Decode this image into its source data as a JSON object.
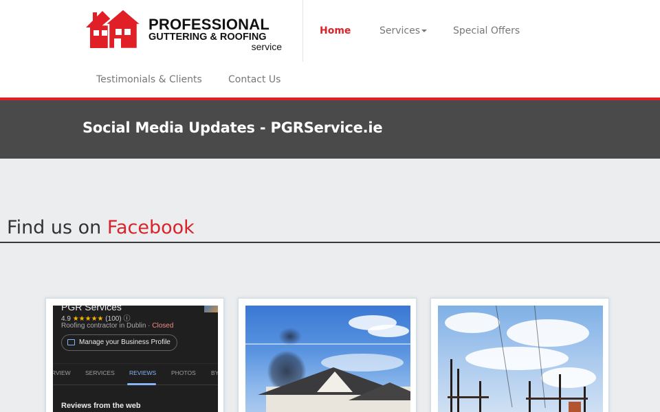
{
  "logo": {
    "line1": "PROFESSIONAL",
    "line2": "GUTTERING & ROOFING",
    "line3": "service"
  },
  "nav": {
    "home": "Home",
    "services": "Services",
    "special_offers": "Special Offers",
    "testimonials": "Testimonials & Clients",
    "contact": "Contact Us"
  },
  "banner": {
    "title": "Social Media Updates - PGRService.ie"
  },
  "section": {
    "title_prefix": "Find us on ",
    "title_accent": "Facebook"
  },
  "cards": {
    "card1": {
      "business_name": "PGR Services",
      "rating": "4.9",
      "stars": "★★★★★",
      "review_count": "(100)",
      "info_glyph": "ⓘ",
      "category": "Roofing contractor in Dublin · ",
      "status": "Closed",
      "manage_label": "Manage your Business Profile",
      "tabs": [
        "RVIEW",
        "SERVICES",
        "REVIEWS",
        "PHOTOS",
        "BY"
      ],
      "reviews_heading": "Reviews from the web"
    }
  },
  "colors": {
    "accent": "#d9232a",
    "banner_bg": "#4a4a4a",
    "red_line": "#e01f26"
  },
  "icons": {
    "logo": "house-logo-icon",
    "services_caret": "caret-down-icon",
    "store": "store-icon"
  }
}
